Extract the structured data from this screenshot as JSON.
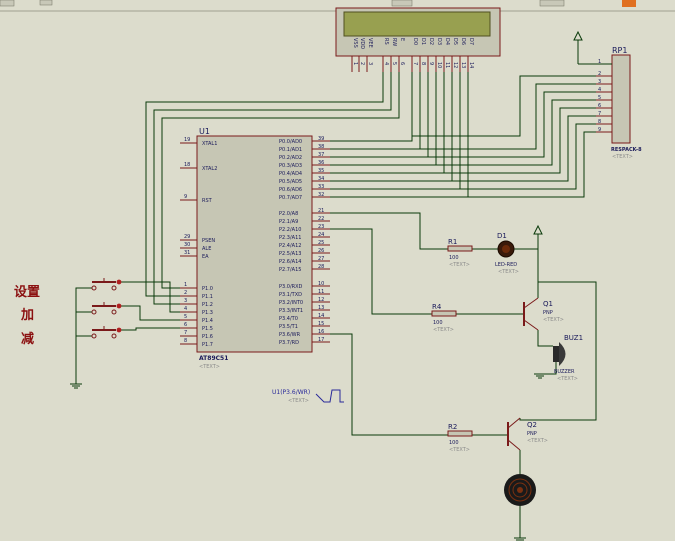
{
  "mcu": {
    "ref": "U1",
    "part": "AT89C51",
    "text_placeholder": "<TEXT>",
    "left_pins": [
      {
        "num": "19",
        "name": "XTAL1"
      },
      {
        "num": "18",
        "name": "XTAL2"
      },
      {
        "num": "9",
        "name": "RST"
      },
      {
        "num": "29",
        "name": "PSEN"
      },
      {
        "num": "30",
        "name": "ALE"
      },
      {
        "num": "31",
        "name": "EA"
      },
      {
        "num": "1",
        "name": "P1.0"
      },
      {
        "num": "2",
        "name": "P1.1"
      },
      {
        "num": "3",
        "name": "P1.2"
      },
      {
        "num": "4",
        "name": "P1.3"
      },
      {
        "num": "5",
        "name": "P1.4"
      },
      {
        "num": "6",
        "name": "P1.5"
      },
      {
        "num": "7",
        "name": "P1.6"
      },
      {
        "num": "8",
        "name": "P1.7"
      }
    ],
    "right_pins": [
      {
        "num": "39",
        "name": "P0.0/AD0"
      },
      {
        "num": "38",
        "name": "P0.1/AD1"
      },
      {
        "num": "37",
        "name": "P0.2/AD2"
      },
      {
        "num": "36",
        "name": "P0.3/AD3"
      },
      {
        "num": "35",
        "name": "P0.4/AD4"
      },
      {
        "num": "34",
        "name": "P0.5/AD5"
      },
      {
        "num": "33",
        "name": "P0.6/AD6"
      },
      {
        "num": "32",
        "name": "P0.7/AD7"
      },
      {
        "num": "21",
        "name": "P2.0/A8"
      },
      {
        "num": "22",
        "name": "P2.1/A9"
      },
      {
        "num": "23",
        "name": "P2.2/A10"
      },
      {
        "num": "24",
        "name": "P2.3/A11"
      },
      {
        "num": "25",
        "name": "P2.4/A12"
      },
      {
        "num": "26",
        "name": "P2.5/A13"
      },
      {
        "num": "27",
        "name": "P2.6/A14"
      },
      {
        "num": "28",
        "name": "P2.7/A15"
      },
      {
        "num": "10",
        "name": "P3.0/RXD"
      },
      {
        "num": "11",
        "name": "P3.1/TXD"
      },
      {
        "num": "12",
        "name": "P3.2/INT0"
      },
      {
        "num": "13",
        "name": "P3.3/INT1"
      },
      {
        "num": "14",
        "name": "P3.4/T0"
      },
      {
        "num": "15",
        "name": "P3.5/T1"
      },
      {
        "num": "16",
        "name": "P3.6/WR"
      },
      {
        "num": "17",
        "name": "P3.7/RD"
      }
    ]
  },
  "lcd": {
    "pin_labels": [
      "VSS",
      "VDD",
      "VEE",
      "RS",
      "RW",
      "E",
      "D0",
      "D1",
      "D2",
      "D3",
      "D4",
      "D5",
      "D6",
      "D7"
    ],
    "pin_numbers": [
      "1",
      "2",
      "3",
      "4",
      "5",
      "6",
      "7",
      "8",
      "9",
      "10",
      "11",
      "12",
      "13",
      "14"
    ]
  },
  "rp1": {
    "ref": "RP1",
    "part": "RESPACK-8",
    "text_placeholder": "<TEXT>",
    "pins": [
      "1",
      "2",
      "3",
      "4",
      "5",
      "6",
      "7",
      "8",
      "9"
    ]
  },
  "r1": {
    "ref": "R1",
    "value": "100",
    "text_placeholder": "<TEXT>"
  },
  "r4": {
    "ref": "R4",
    "value": "100",
    "text_placeholder": "<TEXT>"
  },
  "r2": {
    "ref": "R2",
    "value": "100",
    "text_placeholder": "<TEXT>"
  },
  "d1": {
    "ref": "D1",
    "part": "LED-RED",
    "text_placeholder": "<TEXT>"
  },
  "q1": {
    "ref": "Q1",
    "part": "PNP",
    "text_placeholder": "<TEXT>"
  },
  "q2": {
    "ref": "Q2",
    "part": "PNP",
    "text_placeholder": "<TEXT>"
  },
  "buz1": {
    "ref": "BUZ1",
    "part": "BUZZER",
    "text_placeholder": "<TEXT>"
  },
  "clock_probe": {
    "label": "U1(P3.6/WR)",
    "text_placeholder": "<TEXT>"
  },
  "buttons_label": [
    "设置",
    "加",
    "减"
  ],
  "colors": {
    "background": "#dcdccc",
    "wire": "#0a3a0a",
    "component": "#7a1a1a",
    "chip_fill": "#c6c6b4",
    "label": "#1a1a5a",
    "placeholder": "#8a8a8a",
    "chinese_label": "#8b1010",
    "lcd_screen": "#98a050"
  }
}
